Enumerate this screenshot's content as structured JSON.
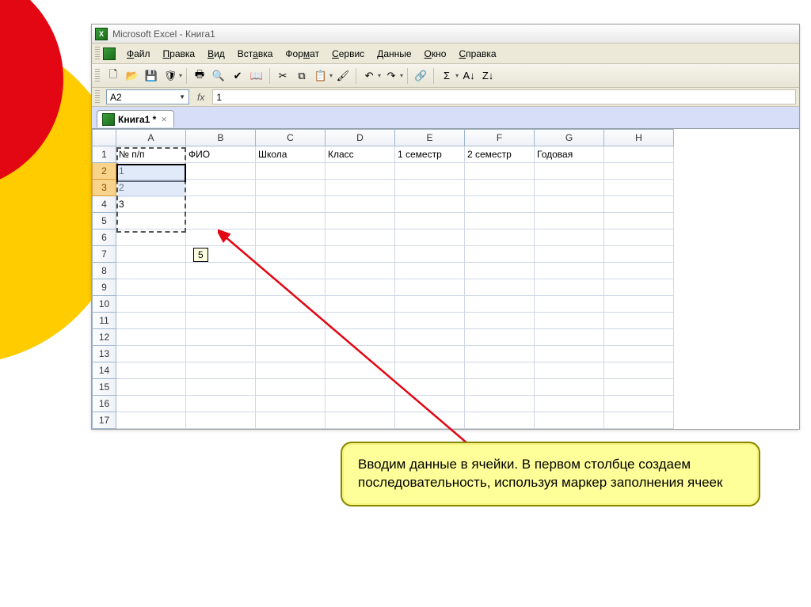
{
  "window": {
    "title": "Microsoft Excel - Книга1"
  },
  "menu": {
    "items": [
      "Файл",
      "Правка",
      "Вид",
      "Вставка",
      "Формат",
      "Сервис",
      "Данные",
      "Окно",
      "Справка"
    ]
  },
  "toolbar": {
    "icons": [
      {
        "name": "new-doc-icon",
        "glyph": "🗋"
      },
      {
        "name": "open-icon",
        "glyph": "📂"
      },
      {
        "name": "save-icon",
        "glyph": "💾"
      },
      {
        "name": "permissions-icon",
        "glyph": "🛡"
      },
      {
        "name": "print-icon",
        "glyph": "🖶"
      },
      {
        "name": "print-preview-icon",
        "glyph": "🔍"
      },
      {
        "name": "spellcheck-icon",
        "glyph": "✔"
      },
      {
        "name": "research-icon",
        "glyph": "📖"
      },
      {
        "name": "cut-icon",
        "glyph": "✂"
      },
      {
        "name": "copy-icon",
        "glyph": "⧉"
      },
      {
        "name": "paste-icon",
        "glyph": "📋"
      },
      {
        "name": "format-painter-icon",
        "glyph": "🖌"
      },
      {
        "name": "undo-icon",
        "glyph": "↶"
      },
      {
        "name": "redo-icon",
        "glyph": "↷"
      },
      {
        "name": "hyperlink-icon",
        "glyph": "🔗"
      },
      {
        "name": "autosum-icon",
        "glyph": "Σ"
      },
      {
        "name": "sort-asc-icon",
        "glyph": "A↓"
      },
      {
        "name": "sort-desc-icon",
        "glyph": "Z↓"
      }
    ]
  },
  "formula_bar": {
    "name_box": "A2",
    "fx_label": "fx",
    "value": "1"
  },
  "doc_tab": {
    "label": "Книга1 *"
  },
  "columns": [
    "A",
    "B",
    "C",
    "D",
    "E",
    "F",
    "G",
    "H"
  ],
  "rows": [
    "1",
    "2",
    "3",
    "4",
    "5",
    "6",
    "7",
    "8",
    "9",
    "10",
    "11",
    "12",
    "13",
    "14",
    "15",
    "16",
    "17"
  ],
  "data": {
    "r1": {
      "A": "№ п/п",
      "B": "ФИО",
      "C": "Школа",
      "D": "Класс",
      "E": "1 семестр",
      "F": "2 семестр",
      "G": "Годовая"
    },
    "r2": {
      "A": "1"
    },
    "r3": {
      "A": "2"
    },
    "r4": {
      "A": "3"
    }
  },
  "drag_tooltip": "5",
  "callout": {
    "text": "Вводим данные в ячейки. В первом столбце создаем последовательность, используя маркер заполнения ячеек"
  }
}
